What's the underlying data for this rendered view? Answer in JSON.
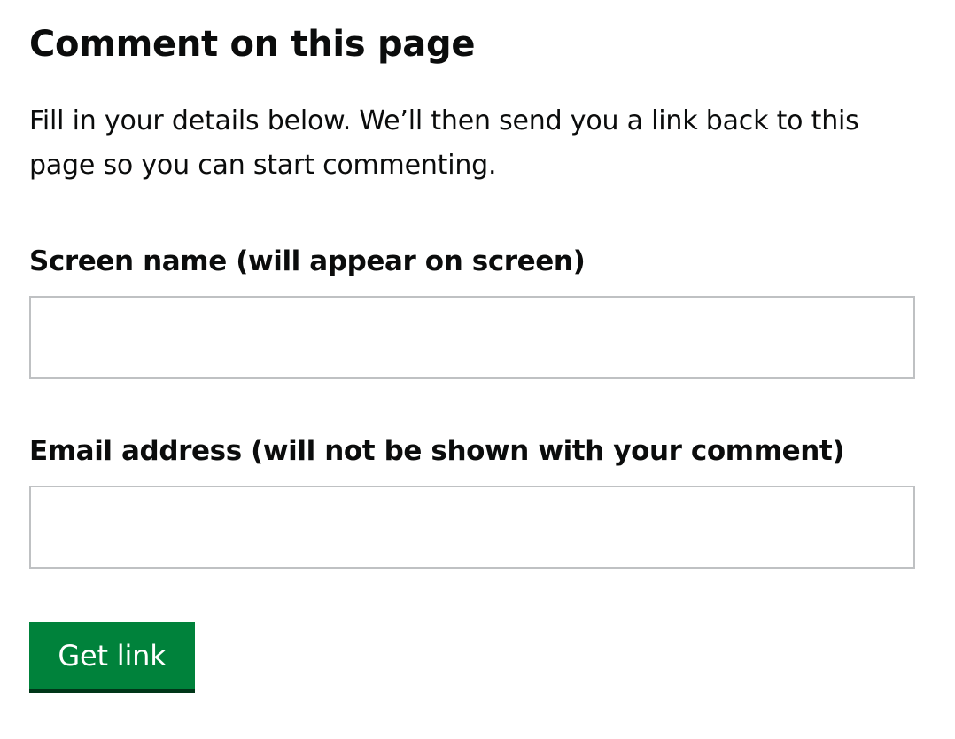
{
  "form": {
    "title": "Comment on this page",
    "intro": "Fill in your details below. We’ll then send you a link back to this page so you can start commenting.",
    "screen_name": {
      "label": "Screen name (will appear on screen)",
      "value": ""
    },
    "email": {
      "label": "Email address (will not be shown with your comment)",
      "value": ""
    },
    "submit_label": "Get link"
  },
  "colors": {
    "button_background": "#00823b",
    "button_shadow": "#003618",
    "input_border": "#bfc1c3",
    "text": "#0b0c0c"
  }
}
